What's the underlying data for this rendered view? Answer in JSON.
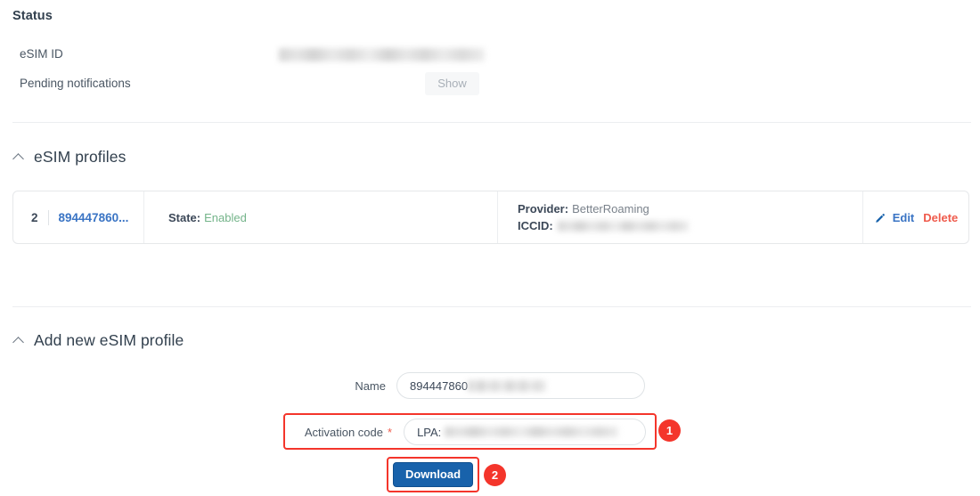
{
  "status": {
    "title": "Status",
    "esim_id_label": "eSIM ID",
    "esim_id_value": "",
    "pending_label": "Pending notifications",
    "show_button": "Show"
  },
  "profiles_section": {
    "title": "eSIM profiles",
    "caret_icon": "chevron-up-icon",
    "rows": [
      {
        "index": "2",
        "name_link": "894447860...",
        "state_key": "State:",
        "state_value": "Enabled",
        "provider_key": "Provider:",
        "provider_value": "BetterRoaming",
        "iccid_key": "ICCID:",
        "iccid_value": "",
        "edit_label": "Edit",
        "delete_label": "Delete",
        "edit_icon": "pencil-icon"
      }
    ]
  },
  "add_section": {
    "title": "Add new eSIM profile",
    "caret_icon": "chevron-up-icon",
    "name_label": "Name",
    "name_value": "894447860",
    "activation_label": "Activation code",
    "required_marker": "*",
    "activation_value": "LPA:",
    "download_label": "Download"
  },
  "annotations": {
    "badge_1": "1",
    "badge_2": "2",
    "highlight_color": "#f4352b"
  },
  "colors": {
    "link_blue": "#3a74c4",
    "primary_blue": "#1862ab",
    "danger_red": "#ef5b4c",
    "success_green": "#74b48a",
    "annotation_red": "#f4352b"
  }
}
